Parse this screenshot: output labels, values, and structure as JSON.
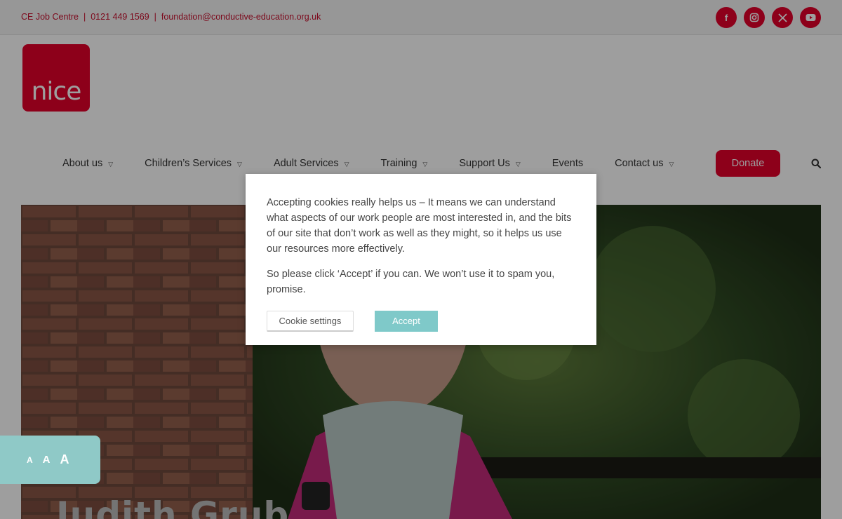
{
  "topbar": {
    "job_centre": "CE Job Centre",
    "phone": "0121 449 1569",
    "email": "foundation@conductive-education.org.uk",
    "separator": "|",
    "socials": [
      {
        "name": "facebook-icon",
        "glyph": "f"
      },
      {
        "name": "instagram-icon",
        "glyph": "◎"
      },
      {
        "name": "x-icon",
        "glyph": "𝕏"
      },
      {
        "name": "youtube-icon",
        "glyph": "▶"
      }
    ]
  },
  "logo": {
    "text": "nice"
  },
  "nav": {
    "items": [
      {
        "label": "About us",
        "dropdown": true
      },
      {
        "label": "Children’s Services",
        "dropdown": true
      },
      {
        "label": "Adult Services",
        "dropdown": true
      },
      {
        "label": "Training",
        "dropdown": true
      },
      {
        "label": "Support Us",
        "dropdown": true
      },
      {
        "label": "Events",
        "dropdown": false
      },
      {
        "label": "Contact us",
        "dropdown": true
      }
    ],
    "donate_label": "Donate"
  },
  "hero": {
    "title": "Judith Grub"
  },
  "a11y": {
    "small": "A",
    "medium": "A",
    "large": "A"
  },
  "cookie": {
    "paragraph1": "Accepting cookies really helps us – It means we can understand what aspects of our work people are most interested in, and the bits of our site that don’t work as well as they might, so it helps us use our resources more effectively.",
    "paragraph2": "So please click ‘Accept’ if you can. We won’t use it to spam you, promise.",
    "settings_label": "Cookie settings",
    "accept_label": "Accept"
  },
  "colors": {
    "brand": "#e4002b",
    "accept": "#7fc9c9",
    "a11y": "#8fc9c7"
  }
}
